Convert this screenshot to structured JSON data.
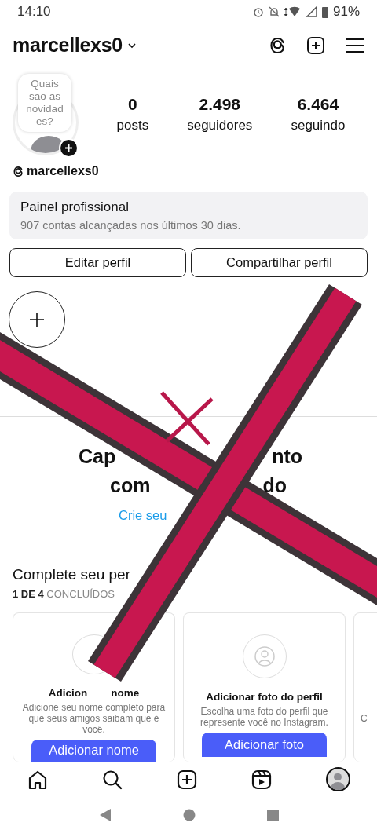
{
  "status_bar": {
    "time": "14:10",
    "battery": "91%"
  },
  "header": {
    "username": "marcellexs0"
  },
  "profile": {
    "note": "Quais são as novidad es?",
    "stats": [
      {
        "value": "0",
        "label": "posts"
      },
      {
        "value": "2.498",
        "label": "seguidores"
      },
      {
        "value": "6.464",
        "label": "seguindo"
      }
    ],
    "threads_handle": "marcellexs0"
  },
  "dashboard": {
    "title": "Painel profissional",
    "subtitle": "907 contas alcançadas nos últimos 30 dias."
  },
  "buttons": [
    "Editar perfil",
    "Compartilhar perfil"
  ],
  "empty_state": {
    "headline_lines": [
      [
        "Cap",
        "nto"
      ],
      [
        "com",
        "do"
      ]
    ],
    "link": "Crie seu"
  },
  "complete_profile": {
    "title": "Complete seu per",
    "progress": "**1 DE 4** CONCLUÍDOS",
    "cards": [
      {
        "kind": "name",
        "title_parts": [
          "Adicion",
          "nome"
        ],
        "description": "Adicione seu nome completo para que seus amigos saibam que é você.",
        "button": "Adicionar nome"
      },
      {
        "kind": "photo",
        "title_parts": [
          "Adicionar foto do perfil"
        ],
        "description": "Escolha uma foto do perfil que represente você no Instagram.",
        "button": "Adicionar foto"
      },
      {
        "kind": "partial",
        "description": "C"
      }
    ]
  },
  "bottom_nav": [
    {
      "kind": "home",
      "selected": false
    },
    {
      "kind": "search",
      "selected": false
    },
    {
      "kind": "create",
      "selected": false
    },
    {
      "kind": "reels",
      "selected": false
    },
    {
      "kind": "profile",
      "selected": true
    }
  ]
}
